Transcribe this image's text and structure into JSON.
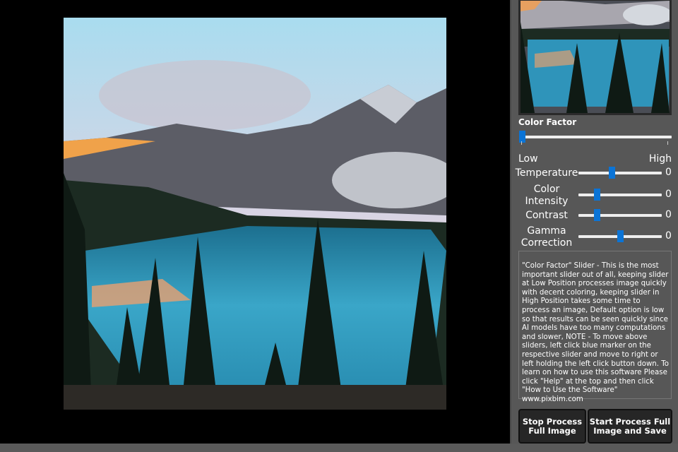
{
  "photo": {
    "description_icon": "landscape-image"
  },
  "color_factor": {
    "label": "Color Factor",
    "low_label": "Low",
    "high_label": "High",
    "position": 0
  },
  "sliders": [
    {
      "label": "Temperature",
      "value": "0",
      "position": 0.4
    },
    {
      "label": "Color Intensity",
      "value": "0",
      "position": 0.22
    },
    {
      "label": "Contrast",
      "value": "0",
      "position": 0.22
    },
    {
      "label": "Gamma Correction",
      "value": "0",
      "position": 0.5
    }
  ],
  "help_text": "\"Color Factor\" Slider - This is the most important slider out of all, keeping slider at Low Position processes image quickly with decent coloring, keeping slider in High Position takes some time to process an image, Default option is low so that results can be seen quickly since AI models have too many computations and slower, NOTE - To move above sliders, left click blue marker on the respective slider and move to right or left holding the left click button down. To learn on how to use this software Please click \"Help\" at the top and then click \"How to Use the Software\" www.pixbim.com",
  "buttons": {
    "stop": "Stop Process Full Image",
    "start": "Start Process Full Image and Save"
  },
  "colors": {
    "accent": "#0b74d6",
    "panel": "#575757"
  }
}
